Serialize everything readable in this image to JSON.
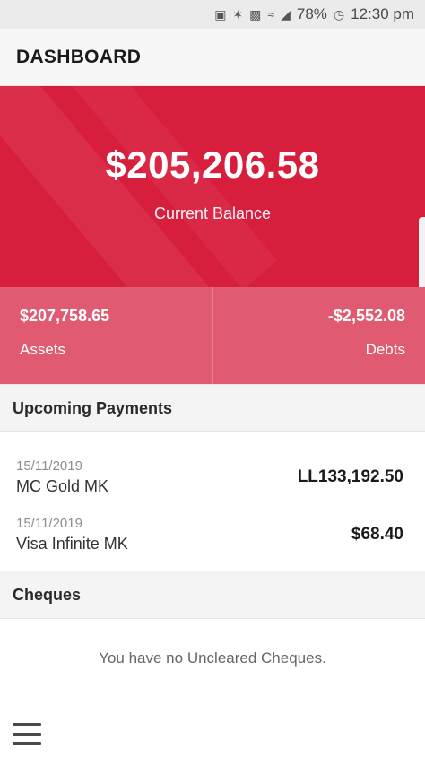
{
  "status_bar": {
    "battery": "78%",
    "time": "12:30 pm",
    "icons": [
      "notification-icon",
      "bluetooth-icon",
      "nfc-icon",
      "wifi-icon",
      "signal-icon",
      "alarm-icon"
    ]
  },
  "header": {
    "title": "DASHBOARD"
  },
  "balance": {
    "amount": "$205,206.58",
    "label": "Current Balance"
  },
  "summary": {
    "assets": {
      "amount": "$207,758.65",
      "label": "Assets"
    },
    "debts": {
      "amount": "-$2,552.08",
      "label": "Debts"
    }
  },
  "upcoming": {
    "title": "Upcoming Payments",
    "items": [
      {
        "date": "15/11/2019",
        "name": "MC Gold MK",
        "amount": "LL133,192.50"
      },
      {
        "date": "15/11/2019",
        "name": "Visa Infinite MK",
        "amount": "$68.40"
      }
    ]
  },
  "cheques": {
    "title": "Cheques",
    "empty_message": "You have no Uncleared Cheques."
  },
  "colors": {
    "brand_red": "#d81e3d",
    "summary_red": "#e05a72"
  }
}
